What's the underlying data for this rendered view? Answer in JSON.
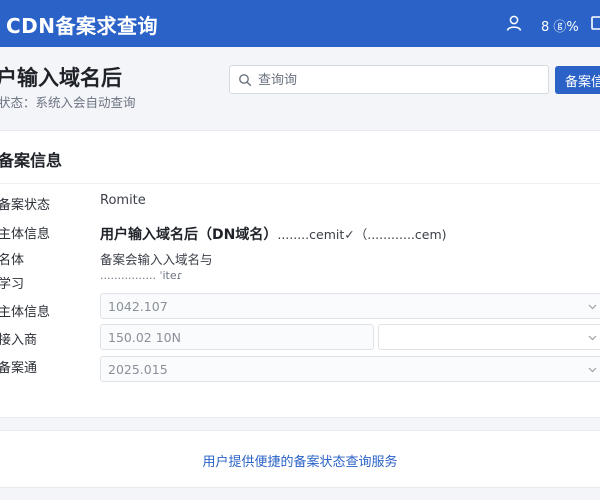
{
  "header": {
    "app_title": "CDN备案求查询",
    "status_text": "8 ⓖ%",
    "icons": [
      "user-icon",
      "document-icon"
    ]
  },
  "page": {
    "title": "户输入域名后",
    "subtitle": "状态：系统入会自动查询"
  },
  "search": {
    "placeholder": "查询询",
    "button_label": "备案信"
  },
  "record": {
    "section_title": "备案信息",
    "labels": {
      "status": "备案状态",
      "subject": "主体信息",
      "name": "名体",
      "study": "学习",
      "subject2": "主体信息",
      "isp": "接入商",
      "record_no": "备案通"
    },
    "status_value": "Romite",
    "subject_main": "用户输入域名后（DN域名）",
    "subject_extra": "........cemit✓（............cem)",
    "name_value": "备案会输入入域名与",
    "study_value": "................ ˈiteɾ",
    "fields": {
      "subject2": "1042.107",
      "isp": "150.02 10N",
      "record_no": "2025.015"
    }
  },
  "footer": {
    "text": "用户提供便捷的备案状态查询服务"
  }
}
